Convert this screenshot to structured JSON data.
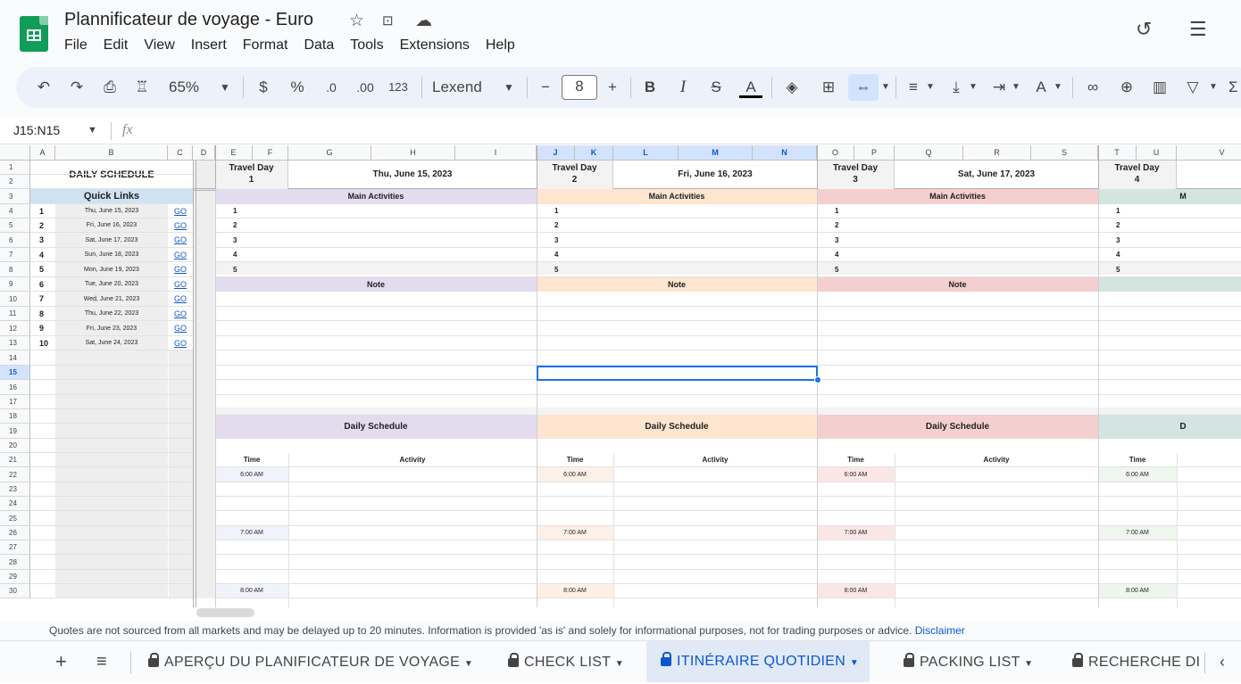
{
  "app": {
    "title": "Plannificateur de voyage - Euro",
    "menu": [
      "File",
      "Edit",
      "View",
      "Insert",
      "Format",
      "Data",
      "Tools",
      "Extensions",
      "Help"
    ]
  },
  "toolbar": {
    "zoom": "65%",
    "currency": "$",
    "percent": "%",
    "dec_decrease": ".0",
    "dec_increase": ".00",
    "format_123": "123",
    "font": "Lexend",
    "font_size": "8",
    "minus": "−",
    "plus": "+",
    "bold": "B",
    "italic": "I",
    "strike": "S",
    "text_color": "A"
  },
  "formula_bar": {
    "name_box": "J15:N15",
    "fx": "fx",
    "value": ""
  },
  "columns": [
    "A",
    "B",
    "C",
    "D",
    "E",
    "F",
    "G",
    "H",
    "I",
    "J",
    "K",
    "L",
    "M",
    "N",
    "O",
    "P",
    "Q",
    "R",
    "S",
    "T",
    "U",
    "V"
  ],
  "rows": [
    "1",
    "2",
    "3",
    "4",
    "5",
    "6",
    "7",
    "8",
    "9",
    "10",
    "11",
    "12",
    "13",
    "14",
    "15",
    "16",
    "17",
    "18",
    "19",
    "20",
    "21",
    "22",
    "23",
    "24",
    "25",
    "26",
    "27",
    "28",
    "29",
    "30"
  ],
  "sidebar": {
    "title": "DAILY SCHEDULE",
    "quick_links_title": "Quick Links",
    "links": [
      {
        "num": "1",
        "date": "Thu, June 15, 2023",
        "go": "GO"
      },
      {
        "num": "2",
        "date": "Fri, June 16, 2023",
        "go": "GO"
      },
      {
        "num": "3",
        "date": "Sat, June 17, 2023",
        "go": "GO"
      },
      {
        "num": "4",
        "date": "Sun, June 18, 2023",
        "go": "GO"
      },
      {
        "num": "5",
        "date": "Mon, June 19, 2023",
        "go": "GO"
      },
      {
        "num": "6",
        "date": "Tue, June 20, 2023",
        "go": "GO"
      },
      {
        "num": "7",
        "date": "Wed, June 21, 2023",
        "go": "GO"
      },
      {
        "num": "8",
        "date": "Thu, June 22, 2023",
        "go": "GO"
      },
      {
        "num": "9",
        "date": "Fri, June 23, 2023",
        "go": "GO"
      },
      {
        "num": "10",
        "date": "Sat, June 24, 2023",
        "go": "GO"
      }
    ]
  },
  "days": [
    {
      "label": "Travel Day",
      "num": "1",
      "date": "Thu, June 15, 2023",
      "main": "Main Activities",
      "note": "Note",
      "schedule": "Daily Schedule",
      "time": "Time",
      "activity": "Activity",
      "color": "#e3dcef",
      "tint": "#f1f3fb"
    },
    {
      "label": "Travel Day",
      "num": "2",
      "date": "Fri, June 16, 2023",
      "main": "Main Activities",
      "note": "Note",
      "schedule": "Daily Schedule",
      "time": "Time",
      "activity": "Activity",
      "color": "#fde5cf",
      "tint": "#fdf0e6"
    },
    {
      "label": "Travel Day",
      "num": "3",
      "date": "Sat, June 17, 2023",
      "main": "Main Activities",
      "note": "Note",
      "schedule": "Daily Schedule",
      "time": "Time",
      "activity": "Activity",
      "color": "#f4cfd0",
      "tint": "#fbe6e6"
    },
    {
      "label": "Travel Day",
      "num": "4",
      "date": "",
      "main": "M",
      "note": "",
      "schedule": "D",
      "time": "Time",
      "activity": "",
      "color": "#d3e4e1",
      "tint": "#eef6ee"
    }
  ],
  "activity_numbers": [
    "1",
    "2",
    "3",
    "4",
    "5"
  ],
  "times": [
    "6:00 AM",
    "7:00 AM",
    "8:00 AM"
  ],
  "footer": {
    "quote": "Quotes are not sourced from all markets and may be delayed up to 20 minutes. Information is provided 'as is' and solely for informational purposes, not for trading purposes or advice.",
    "disclaimer": "Disclaimer"
  },
  "sheet_tabs": [
    {
      "label": "APERÇU DU PLANIFICATEUR DE VOYAGE",
      "active": false
    },
    {
      "label": "CHECK LIST",
      "active": false
    },
    {
      "label": "ITINÉRAIRE QUOTIDIEN",
      "active": true
    },
    {
      "label": "PACKING LIST",
      "active": false
    },
    {
      "label": "RECHERCHE DI",
      "active": false
    }
  ],
  "colors": {
    "accent": "#0b57d0",
    "sheets_green": "#0f9d58",
    "link_blue": "#1155cc",
    "header_selected": "#d3e3fd"
  }
}
